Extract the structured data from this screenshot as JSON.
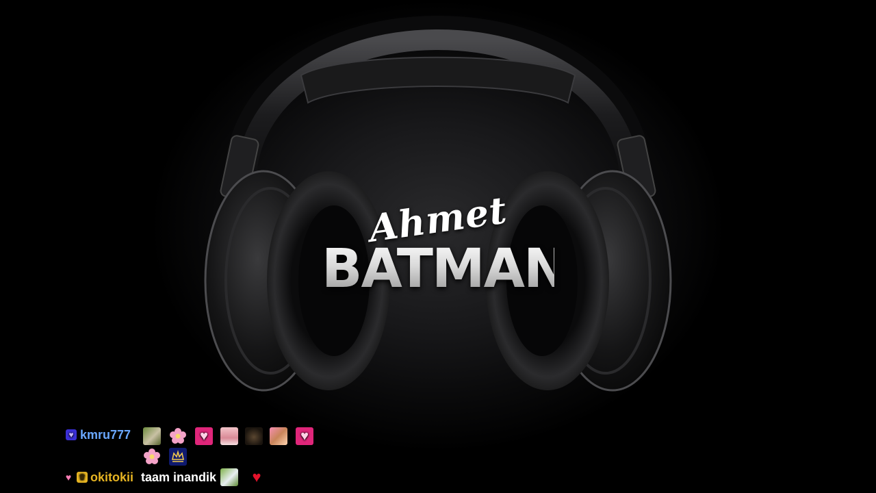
{
  "logo": {
    "script_text": "Ahmet",
    "main_text": "BATMAN"
  },
  "chat": {
    "messages": [
      {
        "username": "kmru777",
        "username_color": "#6aa8ff",
        "badges": [
          "purple-heart-icon"
        ],
        "emotes": [
          "bird-emote",
          "flower-emote",
          "pink-heart-emote",
          "pink-blush-emote",
          "cat-emote",
          "fox-emote",
          "pink-heart-emote",
          "flower-emote",
          "crown-emote"
        ],
        "text": ""
      },
      {
        "username": "okitokii",
        "username_color": "#e6b422",
        "badges": [
          "pink-heart-icon",
          "crown-badge-icon"
        ],
        "emotes": [
          "pigeon-emote",
          "red-heart-emote"
        ],
        "text": "taam inandik"
      }
    ]
  }
}
